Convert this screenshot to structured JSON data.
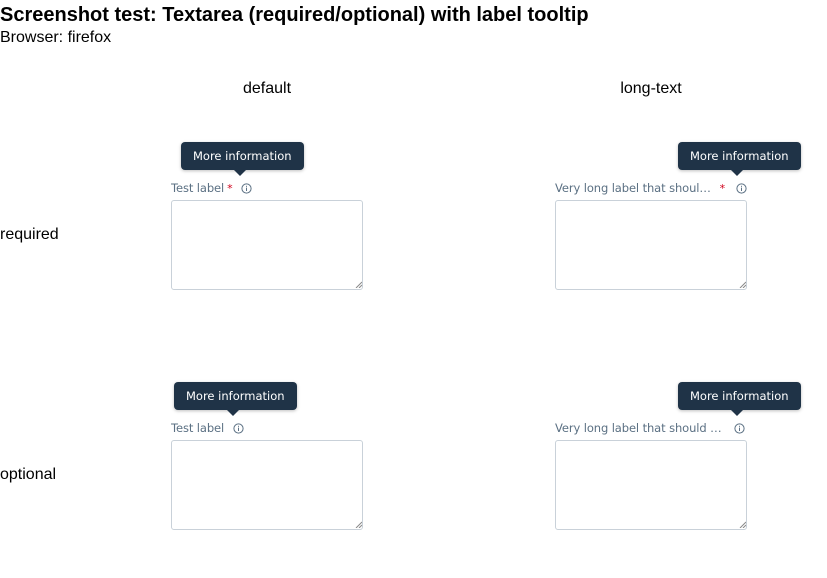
{
  "page": {
    "title": "Screenshot test: Textarea (required/optional) with label tooltip",
    "browser_line": "Browser: firefox"
  },
  "columns": [
    "default",
    "long-text"
  ],
  "rows": [
    "required",
    "optional"
  ],
  "fields": {
    "required_default": {
      "label": "Test label",
      "required_marker": "*",
      "tooltip": "More information",
      "value": ""
    },
    "required_long": {
      "label": "Very long label that should be truncated",
      "required_marker": "*",
      "tooltip": "More information",
      "value": ""
    },
    "optional_default": {
      "label": "Test label",
      "tooltip": "More information",
      "value": ""
    },
    "optional_long": {
      "label": "Very long label that should be truncated",
      "tooltip": "More information",
      "value": ""
    }
  },
  "icons": {
    "info": "info-circle-icon",
    "resize": "resize-handle-icon"
  },
  "colors": {
    "tooltip_bg": "#1f3347",
    "label_text": "#5b7083",
    "required_star": "#d0021b",
    "textarea_border": "#c9d1d9"
  }
}
